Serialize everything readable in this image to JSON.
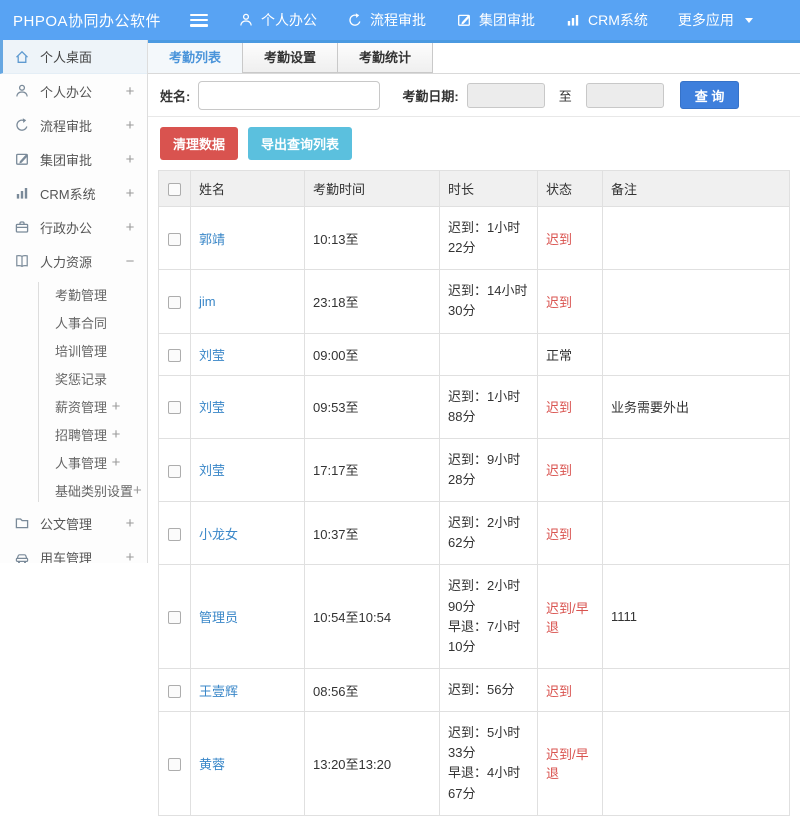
{
  "colors": {
    "header_bg": "#58a3f3",
    "tab_accent_blue": "#4b9ae1",
    "search_button_blue": "#3e7fdc",
    "link_blue": "#3a87c8",
    "danger_red": "#d9534f",
    "info_teal": "#5bc0de",
    "status_red": "#d9534f"
  },
  "header": {
    "title": "PHPOA协同办公软件",
    "nav": [
      {
        "name": "personal-office",
        "label": "个人办公",
        "icon": "person-icon"
      },
      {
        "name": "workflow-approval",
        "label": "流程审批",
        "icon": "process-icon"
      },
      {
        "name": "group-approval",
        "label": "集团审批",
        "icon": "edit-icon"
      },
      {
        "name": "crm-system",
        "label": "CRM系统",
        "icon": "chart-icon"
      },
      {
        "name": "more-apps",
        "label": "更多应用",
        "caret": true
      }
    ]
  },
  "sidebar": {
    "items": [
      {
        "name": "personal-desktop",
        "label": "个人桌面",
        "icon": "home-icon",
        "active": true
      },
      {
        "name": "personal-office",
        "label": "个人办公",
        "icon": "person-icon",
        "expand": "+"
      },
      {
        "name": "workflow-approval",
        "label": "流程审批",
        "icon": "process-icon",
        "expand": "+"
      },
      {
        "name": "group-approval",
        "label": "集团审批",
        "icon": "edit-icon",
        "expand": "+"
      },
      {
        "name": "crm-system",
        "label": "CRM系统",
        "icon": "chart-icon",
        "expand": "+"
      },
      {
        "name": "admin-office",
        "label": "行政办公",
        "icon": "briefcase-icon",
        "expand": "+"
      },
      {
        "name": "human-resources",
        "label": "人力资源",
        "icon": "book-icon",
        "expand": "−",
        "children": [
          {
            "name": "attendance-management",
            "label": "考勤管理"
          },
          {
            "name": "personnel-contract",
            "label": "人事合同"
          },
          {
            "name": "training-management",
            "label": "培训管理"
          },
          {
            "name": "reward-punishment-record",
            "label": "奖惩记录"
          },
          {
            "name": "salary-management",
            "label": "薪资管理",
            "expand": "+"
          },
          {
            "name": "recruitment-management",
            "label": "招聘管理",
            "expand": "+"
          },
          {
            "name": "personnel-management",
            "label": "人事管理",
            "expand": "+"
          },
          {
            "name": "basic-category-settings",
            "label": "基础类别设置",
            "expand": "+"
          }
        ]
      },
      {
        "name": "document-management",
        "label": "公文管理",
        "icon": "folder-icon",
        "expand": "+"
      },
      {
        "name": "vehicle-management",
        "label": "用车管理",
        "icon": "car-icon",
        "expand": "+"
      }
    ]
  },
  "tabs": [
    {
      "name": "attendance-list",
      "label": "考勤列表",
      "active": true
    },
    {
      "name": "attendance-settings",
      "label": "考勤设置"
    },
    {
      "name": "attendance-statistics",
      "label": "考勤统计"
    }
  ],
  "search": {
    "name_label": "姓名:",
    "name_value": "",
    "date_label": "考勤日期:",
    "date_from_value": "",
    "to_label": "至",
    "date_to_value": "",
    "search_button": "查 询"
  },
  "toolbar": {
    "clear_button": "清理数据",
    "export_button": "导出查询列表"
  },
  "table": {
    "columns": [
      "姓名",
      "考勤时间",
      "时长",
      "状态",
      "备注"
    ],
    "normal_status": "正常",
    "rows": [
      {
        "name": "郭靖",
        "time": "10:13至",
        "duration": "迟到：1小时22分",
        "status": "迟到",
        "note": ""
      },
      {
        "name": "jim",
        "time": "23:18至",
        "duration": "迟到：14小时30分",
        "status": "迟到",
        "note": ""
      },
      {
        "name": "刘莹",
        "time": "09:00至",
        "duration": "",
        "status": "正常",
        "note": ""
      },
      {
        "name": "刘莹",
        "time": "09:53至",
        "duration": "迟到：1小时88分",
        "status": "迟到",
        "note": "业务需要外出"
      },
      {
        "name": "刘莹",
        "time": "17:17至",
        "duration": "迟到：9小时28分",
        "status": "迟到",
        "note": ""
      },
      {
        "name": "小龙女",
        "time": "10:37至",
        "duration": "迟到：2小时62分",
        "status": "迟到",
        "note": ""
      },
      {
        "name": "管理员",
        "time": "10:54至10:54",
        "duration": "迟到：2小时90分\n早退：7小时10分",
        "status": "迟到/早退",
        "note": "1111"
      },
      {
        "name": "王壹辉",
        "time": "08:56至",
        "duration": "迟到：56分",
        "status": "迟到",
        "note": ""
      },
      {
        "name": "黄蓉",
        "time": "13:20至13:20",
        "duration": "迟到：5小时33分\n早退：4小时67分",
        "status": "迟到/早退",
        "note": ""
      }
    ]
  }
}
